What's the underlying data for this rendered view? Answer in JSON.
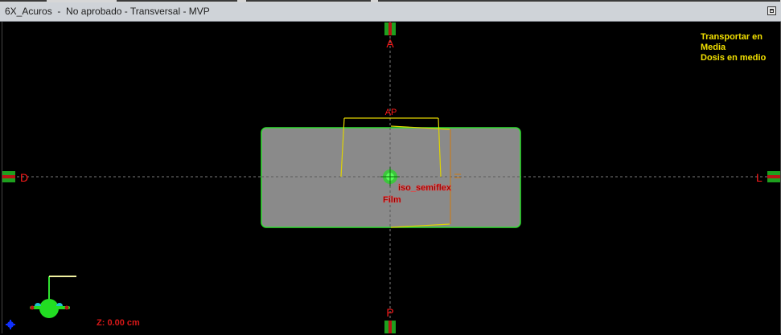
{
  "window": {
    "title": "6X_Acuros  -  No aprobado - Transversal - MVP"
  },
  "orientation": {
    "top": "A",
    "bottom": "P",
    "left": "D",
    "right": "L"
  },
  "structures": {
    "field_label": "AP",
    "isocenter_label": "iso_semiflex",
    "body_label": "Film"
  },
  "overlay": {
    "lines": [
      "Transportar en",
      "Media",
      "Dosis en medio"
    ]
  },
  "status": {
    "z_readout": "Z: 0.00 cm"
  },
  "colors": {
    "phantom_fill": "#8a8a8a",
    "contour": "#2fe02f",
    "beam": "#e0d400",
    "label_red": "#ff1a1a",
    "overlay_text": "#f2e000",
    "marker_green": "#1ea01e",
    "marker_red": "#b81414"
  }
}
